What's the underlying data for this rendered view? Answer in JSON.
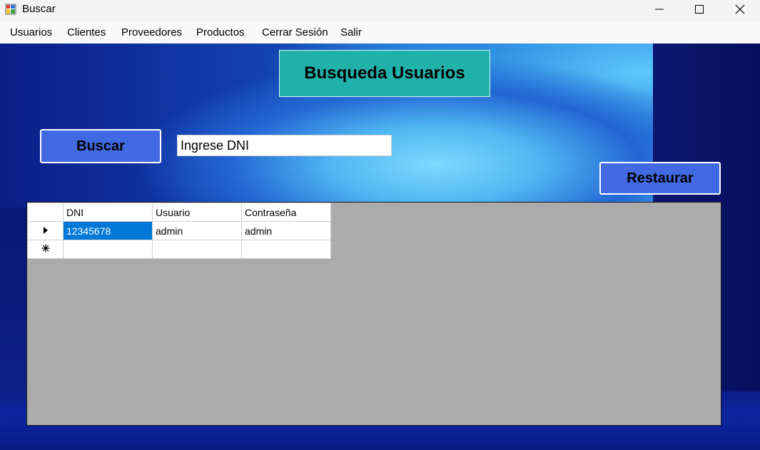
{
  "window": {
    "title": "Buscar",
    "app_icon": "form-icon",
    "controls": [
      "minimize-icon",
      "maximize-icon",
      "close-icon"
    ]
  },
  "menu": {
    "items": [
      "Usuarios",
      "Clientes",
      "Proveedores",
      "Productos",
      "Cerrar Sesión",
      "Salir"
    ]
  },
  "header": {
    "title": "Busqueda Usuarios"
  },
  "actions": {
    "search_label": "Buscar",
    "restore_label": "Restaurar"
  },
  "search": {
    "value": "Ingrese DNI",
    "placeholder": ""
  },
  "grid": {
    "columns": [
      "DNI",
      "Usuario",
      "Contraseña"
    ],
    "rows": [
      {
        "indicator": "current-row-arrow-icon",
        "cells": [
          "12345678",
          "admin",
          "admin"
        ],
        "selected_col": 0
      }
    ],
    "new_row_indicator": "new-row-asterisk-icon"
  },
  "colors": {
    "title_bg": "#20b2aa",
    "button_bg": "#4169e1",
    "selection": "#0078d7",
    "grid_bg": "#ababab"
  }
}
